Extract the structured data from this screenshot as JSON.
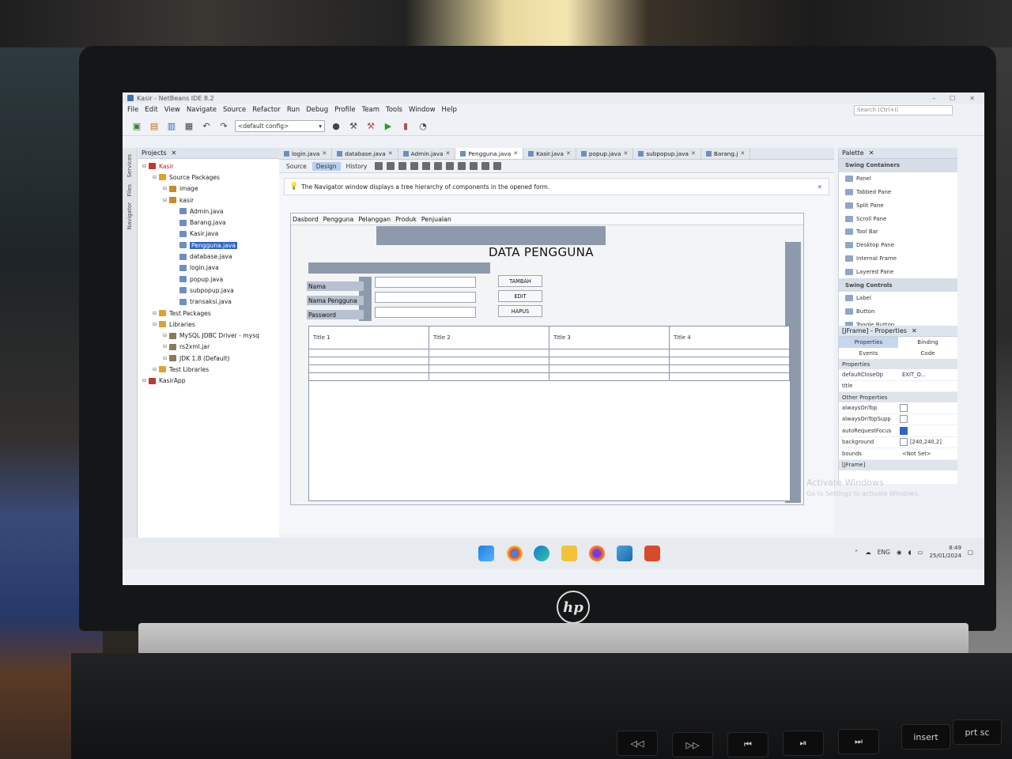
{
  "window": {
    "title": "Kasir - NetBeans IDE 8.2"
  },
  "menu": [
    "File",
    "Edit",
    "View",
    "Navigate",
    "Source",
    "Refactor",
    "Run",
    "Debug",
    "Profile",
    "Team",
    "Tools",
    "Window",
    "Help"
  ],
  "search_placeholder": "Search (Ctrl+I)",
  "toolbar": {
    "config": "<default config>"
  },
  "projects": {
    "tab": "Projects",
    "side_tabs": [
      "Services",
      "Files",
      "Navigator"
    ],
    "tree": [
      {
        "label": "Kasir",
        "indent": 0,
        "icon": "project",
        "red": true
      },
      {
        "label": "Source Packages",
        "indent": 1,
        "icon": "folder"
      },
      {
        "label": "image",
        "indent": 2,
        "icon": "package"
      },
      {
        "label": "kasir",
        "indent": 2,
        "icon": "package"
      },
      {
        "label": "Admin.java",
        "indent": 3,
        "icon": "file"
      },
      {
        "label": "Barang.java",
        "indent": 3,
        "icon": "file"
      },
      {
        "label": "Kasir.java",
        "indent": 3,
        "icon": "file"
      },
      {
        "label": "Pengguna.java",
        "indent": 3,
        "icon": "file",
        "selected": true
      },
      {
        "label": "database.java",
        "indent": 3,
        "icon": "file"
      },
      {
        "label": "login.java",
        "indent": 3,
        "icon": "file"
      },
      {
        "label": "popup.java",
        "indent": 3,
        "icon": "file"
      },
      {
        "label": "subpopup.java",
        "indent": 3,
        "icon": "file"
      },
      {
        "label": "transaksi.java",
        "indent": 3,
        "icon": "file"
      },
      {
        "label": "Test Packages",
        "indent": 1,
        "icon": "folder"
      },
      {
        "label": "Libraries",
        "indent": 1,
        "icon": "folder"
      },
      {
        "label": "MySQL JDBC Driver - mysq",
        "indent": 2,
        "icon": "jar"
      },
      {
        "label": "rs2xml.jar",
        "indent": 2,
        "icon": "jar"
      },
      {
        "label": "JDK 1.8 (Default)",
        "indent": 2,
        "icon": "jar"
      },
      {
        "label": "Test Libraries",
        "indent": 1,
        "icon": "folder"
      },
      {
        "label": "KasirApp",
        "indent": 0,
        "icon": "project"
      }
    ]
  },
  "editor": {
    "file_tabs": [
      "login.java",
      "database.java",
      "Admin.java",
      "Pengguna.java",
      "Kasir.java",
      "popup.java",
      "subpopup.java",
      "Barang.j"
    ],
    "active_tab": "Pengguna.java",
    "view_tabs": [
      "Source",
      "Design",
      "History"
    ],
    "active_view": "Design",
    "info": "The Navigator window displays a tree hierarchy of components in the opened form."
  },
  "form": {
    "menu": [
      "Dasbord",
      "Pengguna",
      "Pelanggan",
      "Produk",
      "Penjualan"
    ],
    "title": "DATA PENGGUNA",
    "labels": [
      "Nama",
      "Nama Pengguna",
      "Password"
    ],
    "buttons": [
      "TAMBAH",
      "EDIT",
      "HAPUS"
    ],
    "table_headers": [
      "Title 1",
      "Title 2",
      "Title 3",
      "Title 4"
    ],
    "table_rows": 4
  },
  "palette": {
    "tab": "Palette",
    "items": [
      {
        "label": "Swing Containers",
        "header": true
      },
      {
        "label": "Panel"
      },
      {
        "label": "Tabbed Pane"
      },
      {
        "label": "Split Pane"
      },
      {
        "label": "Scroll Pane"
      },
      {
        "label": "Tool Bar"
      },
      {
        "label": "Desktop Pane"
      },
      {
        "label": "Internal Frame"
      },
      {
        "label": "Layered Pane"
      },
      {
        "label": "Swing Controls",
        "header": true
      },
      {
        "label": "Label"
      },
      {
        "label": "Button"
      },
      {
        "label": "Toggle Button"
      }
    ]
  },
  "properties": {
    "tab": "[JFrame] - Properties",
    "tabs": [
      "Properties",
      "Binding",
      "Events",
      "Code"
    ],
    "section1": "Properties",
    "rows1": [
      {
        "key": "defaultCloseOp",
        "val": "EXIT_O..."
      },
      {
        "key": "title",
        "val": ""
      }
    ],
    "section2": "Other Properties",
    "rows2": [
      {
        "key": "alwaysOnTop",
        "val": "",
        "cb": false
      },
      {
        "key": "alwaysOnTopSupp",
        "val": "",
        "cb": false
      },
      {
        "key": "autoRequestFocus",
        "val": "",
        "cb": true
      },
      {
        "key": "background",
        "val": "[240,240,2]",
        "cb": false
      },
      {
        "key": "bounds",
        "val": "<Not Set>"
      }
    ],
    "footer": "[JFrame]"
  },
  "watermark": {
    "line1": "Activate Windows",
    "line2": "Go to Settings to activate Windows."
  },
  "tray": {
    "lang": "ENG",
    "time": "8:49",
    "date": "25/01/2024"
  },
  "laptop": {
    "brand": "hp",
    "keys": [
      "insert",
      "prt sc"
    ]
  }
}
